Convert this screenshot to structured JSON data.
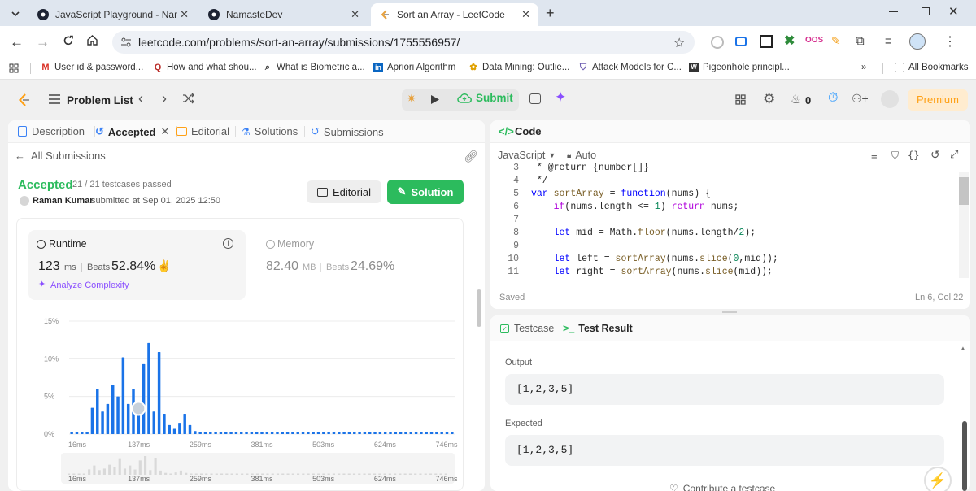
{
  "browser": {
    "tabs": [
      {
        "title": "JavaScript Playground - Namas"
      },
      {
        "title": "NamasteDev"
      },
      {
        "title": "Sort an Array - LeetCode"
      }
    ],
    "url": "leetcode.com/problems/sort-an-array/submissions/1755556957/",
    "bookmarks": [
      {
        "label": "User id & password..."
      },
      {
        "label": "How and what shou..."
      },
      {
        "label": "What is Biometric a..."
      },
      {
        "label": "Apriori Algorithm"
      },
      {
        "label": "Data Mining: Outlie..."
      },
      {
        "label": "Attack Models for C..."
      },
      {
        "label": "Pigeonhole principl..."
      }
    ],
    "bookmarks_overflow": "»",
    "all_bookmarks": "All Bookmarks"
  },
  "topbar": {
    "problem_list": "Problem List",
    "submit": "Submit",
    "streak": "0",
    "premium": "Premium"
  },
  "left": {
    "tabs": {
      "description": "Description",
      "accepted": "Accepted",
      "editorial": "Editorial",
      "solutions": "Solutions",
      "submissions": "Submissions"
    },
    "all_submissions": "All Submissions",
    "status": "Accepted",
    "testcases": "21 / 21 testcases passed",
    "user": "Raman Kumar",
    "submitted_at": "submitted at Sep 01, 2025 12:50",
    "editorial_btn": "Editorial",
    "solution_btn": "Solution",
    "runtime": {
      "label": "Runtime",
      "value": "123",
      "unit": "ms",
      "beats_label": "Beats",
      "beats": "52.84%",
      "analyze": "Analyze Complexity"
    },
    "memory": {
      "label": "Memory",
      "value": "82.40",
      "unit": "MB",
      "beats_label": "Beats",
      "beats": "24.69%"
    }
  },
  "chart_data": {
    "type": "bar",
    "y_ticks": [
      "15%",
      "10%",
      "5%",
      "0%"
    ],
    "x_ticks": [
      "16ms",
      "137ms",
      "259ms",
      "381ms",
      "503ms",
      "624ms",
      "746ms"
    ],
    "ylim": [
      0,
      15
    ],
    "values": [
      0.3,
      0.3,
      0.3,
      0.3,
      3.5,
      6,
      3,
      4,
      6.5,
      5,
      10.2,
      4,
      6,
      3.4,
      9.3,
      12.1,
      3,
      10.9,
      2.7,
      1.2,
      0.7,
      1.5,
      2.7,
      1.2,
      0.4,
      0.3,
      0.3,
      0.3,
      0.3,
      0.3,
      0.3,
      0.3,
      0.3,
      0.3,
      0.3,
      0.3,
      0.3,
      0.3,
      0.3,
      0.3,
      0.3,
      0.3,
      0.3,
      0.3,
      0.3,
      0.3,
      0.3,
      0.3,
      0.3,
      0.3,
      0.3,
      0.3,
      0.3,
      0.3,
      0.3,
      0.3,
      0.3,
      0.3,
      0.3,
      0.3,
      0.3,
      0.3,
      0.3,
      0.3,
      0.3,
      0.3,
      0.3,
      0.3,
      0.3,
      0.3,
      0.3,
      0.3,
      0.3,
      0.3,
      0.3
    ],
    "highlight_index": 13,
    "colors": {
      "bar": "#1a73e8",
      "highlight": "#c8d1db"
    }
  },
  "code": {
    "title": "Code",
    "language": "JavaScript",
    "mode": "Auto",
    "saved": "Saved",
    "cursor": "Ln 6, Col 22",
    "lines": [
      {
        "n": "3",
        "text": " * @return {number[]}"
      },
      {
        "n": "4",
        "text": " */"
      },
      {
        "n": "5",
        "text": "var sortArray = function(nums) {"
      },
      {
        "n": "6",
        "text": "    if(nums.length <= 1) return nums;"
      },
      {
        "n": "7",
        "text": ""
      },
      {
        "n": "8",
        "text": "    let mid = Math.floor(nums.length/2);"
      },
      {
        "n": "9",
        "text": ""
      },
      {
        "n": "10",
        "text": "    let left = sortArray(nums.slice(0,mid));"
      },
      {
        "n": "11",
        "text": "    let right = sortArray(nums.slice(mid));"
      }
    ]
  },
  "result": {
    "testcase_tab": "Testcase",
    "result_tab": "Test Result",
    "output_label": "Output",
    "output_value": "[1,2,3,5]",
    "expected_label": "Expected",
    "expected_value": "[1,2,3,5]",
    "contribute": "Contribute a testcase"
  },
  "colors": {
    "accepted": "#2cbb5d",
    "premium": "#ffa116",
    "link": "#8a4fff"
  }
}
